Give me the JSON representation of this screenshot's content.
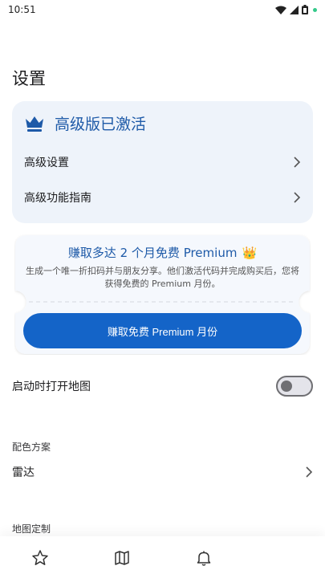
{
  "status_bar": {
    "time": "10:51"
  },
  "page": {
    "title": "设置"
  },
  "premium_card": {
    "header_label": "高级版已激活",
    "rows": [
      {
        "label": "高级设置"
      },
      {
        "label": "高级功能指南"
      }
    ]
  },
  "referral": {
    "title": "赚取多达 2 个月免费 Premium",
    "title_emoji": "👑",
    "description": "生成一个唯一折扣码并与朋友分享。他们激活代码并完成购买后，您将获得免费的 Premium 月份。",
    "button_label": "赚取免费 Premium 月份"
  },
  "settings": {
    "open_map_on_start": {
      "label": "启动时打开地图",
      "enabled": false
    },
    "color_scheme": {
      "section": "配色方案",
      "value": "雷达"
    },
    "map_customization": {
      "section": "地图定制"
    }
  },
  "colors": {
    "accent": "#1464c8",
    "title_blue": "#1e5aa8",
    "card_bg": "#eef3fa"
  },
  "bottom_nav": [
    {
      "icon": "star-icon"
    },
    {
      "icon": "map-icon"
    },
    {
      "icon": "bell-icon"
    }
  ]
}
